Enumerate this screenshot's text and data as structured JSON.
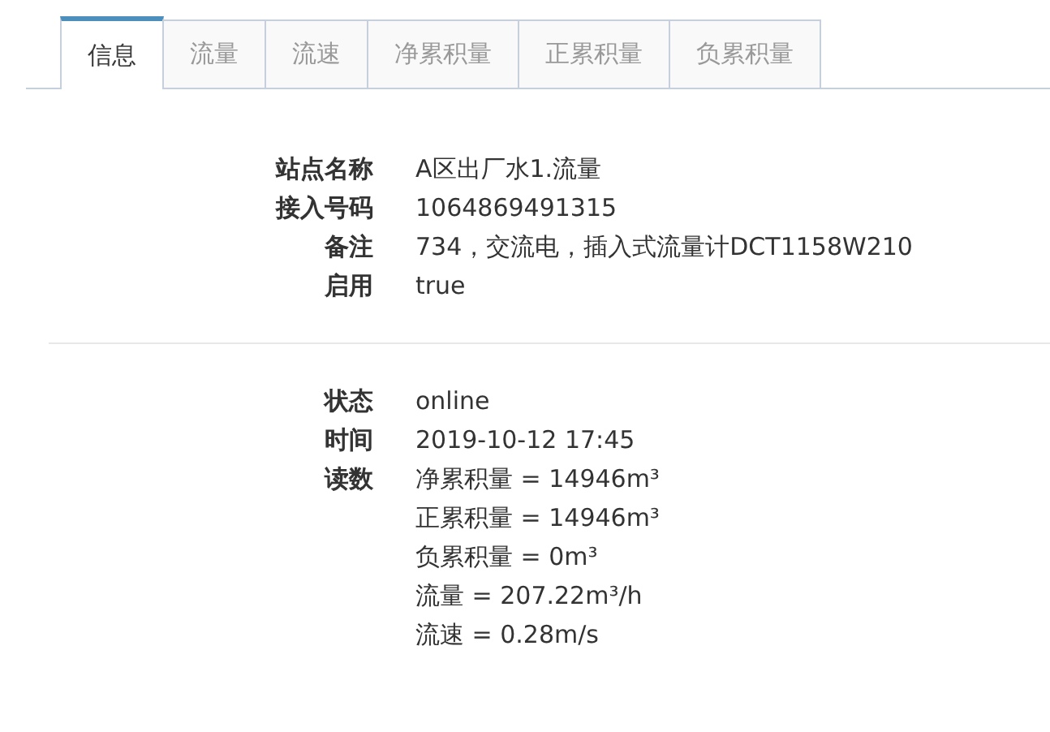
{
  "tabs": [
    {
      "label": "信息",
      "selected": true
    },
    {
      "label": "流量",
      "selected": false
    },
    {
      "label": "流速",
      "selected": false
    },
    {
      "label": "净累积量",
      "selected": false
    },
    {
      "label": "正累积量",
      "selected": false
    },
    {
      "label": "负累积量",
      "selected": false
    }
  ],
  "sections": [
    {
      "fields": [
        {
          "label": "站点名称",
          "values": [
            "A区出厂水1.流量"
          ]
        },
        {
          "label": "接入号码",
          "values": [
            "1064869491315"
          ]
        },
        {
          "label": "备注",
          "values": [
            "734，交流电，插入式流量计DCT1158W210"
          ]
        },
        {
          "label": "启用",
          "values": [
            "true"
          ]
        }
      ]
    },
    {
      "fields": [
        {
          "label": "状态",
          "values": [
            "online"
          ]
        },
        {
          "label": "时间",
          "values": [
            "2019-10-12 17:45"
          ]
        },
        {
          "label": "读数",
          "values": [
            "净累积量 = 14946m³",
            "正累积量 = 14946m³",
            "负累积量 = 0m³",
            "流量 = 207.22m³/h",
            "流速 = 0.28m/s"
          ]
        }
      ]
    }
  ]
}
